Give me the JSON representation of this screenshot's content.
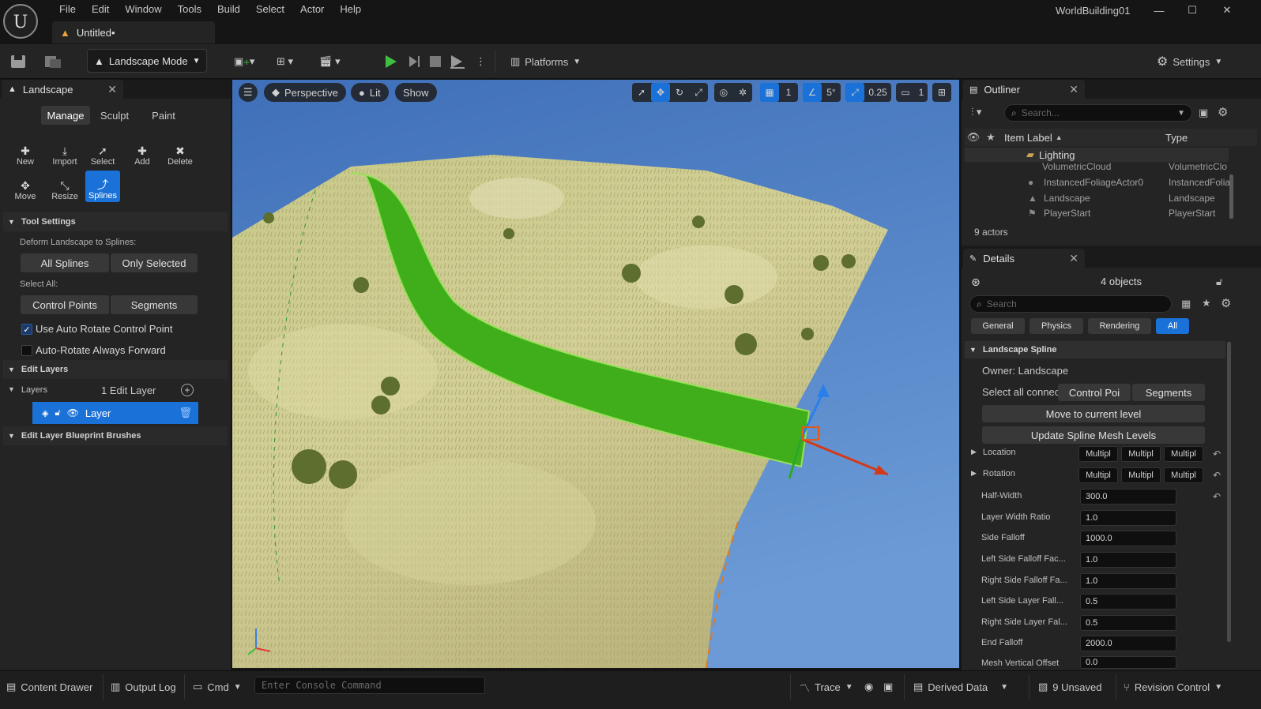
{
  "menu": {
    "items": [
      "File",
      "Edit",
      "Window",
      "Tools",
      "Build",
      "Select",
      "Actor",
      "Help"
    ]
  },
  "window": {
    "project_name": "WorldBuilding01",
    "doc_tab": "Untitled•"
  },
  "toolbar": {
    "mode": "Landscape Mode",
    "platforms": "Platforms",
    "settings": "Settings"
  },
  "landscape_panel": {
    "title": "Landscape",
    "tabs": [
      "Manage",
      "Sculpt",
      "Paint"
    ],
    "tools_row1": [
      "New",
      "Import",
      "Select",
      "Add",
      "Delete"
    ],
    "tools_row2": [
      "Move",
      "Resize",
      "Splines"
    ],
    "tool_settings": {
      "header": "Tool Settings",
      "deform_label": "Deform Landscape to Splines:",
      "all_splines": "All Splines",
      "only_selected": "Only Selected",
      "select_all_label": "Select All:",
      "control_points": "Control Points",
      "segments": "Segments",
      "auto_rotate": "Use Auto Rotate Control Point",
      "auto_rotate_forward": "Auto-Rotate Always Forward"
    },
    "edit_layers": {
      "header": "Edit Layers",
      "layers_label": "Layers",
      "layer_count": "1 Edit Layer",
      "layer_name": "Layer"
    },
    "blueprint_brushes": "Edit Layer Blueprint Brushes"
  },
  "viewport": {
    "perspective": "Perspective",
    "lit": "Lit",
    "show": "Show",
    "grid_value": "1",
    "angle_value": "5°",
    "scale_value": "0.25",
    "camera_speed": "1"
  },
  "outliner": {
    "title": "Outliner",
    "search_placeholder": "Search...",
    "col_label": "Item Label",
    "col_type": "Type",
    "folder": "Lighting",
    "rows": [
      {
        "label": "VolumetricCloud",
        "type": "VolumetricClo"
      },
      {
        "label": "InstancedFoliageActor0",
        "type": "InstancedFolia"
      },
      {
        "label": "Landscape",
        "type": "Landscape"
      },
      {
        "label": "PlayerStart",
        "type": "PlayerStart"
      }
    ],
    "actor_count": "9 actors"
  },
  "details": {
    "title": "Details",
    "objects": "4 objects",
    "search_placeholder": "Search",
    "filters": [
      "General",
      "Physics",
      "Rendering",
      "All"
    ],
    "section": "Landscape Spline",
    "owner": "Owner: Landscape",
    "select_all": "Select all connec",
    "control_points_btn": "Control Poi",
    "segments_btn": "Segments",
    "move_level": "Move to current level",
    "update_mesh": "Update Spline Mesh Levels",
    "location": "Location",
    "rotation": "Rotation",
    "multi": "Multipl",
    "props": [
      {
        "label": "Half-Width",
        "value": "300.0"
      },
      {
        "label": "Layer Width Ratio",
        "value": "1.0"
      },
      {
        "label": "Side Falloff",
        "value": "1000.0"
      },
      {
        "label": "Left Side Falloff Fac...",
        "value": "1.0"
      },
      {
        "label": "Right Side Falloff Fa...",
        "value": "1.0"
      },
      {
        "label": "Left Side Layer Fall...",
        "value": "0.5"
      },
      {
        "label": "Right Side Layer Fal...",
        "value": "0.5"
      },
      {
        "label": "End Falloff",
        "value": "2000.0"
      },
      {
        "label": "Mesh Vertical Offset",
        "value": "0.0"
      }
    ]
  },
  "statusbar": {
    "content_drawer": "Content Drawer",
    "output_log": "Output Log",
    "cmd": "Cmd",
    "console_placeholder": "Enter Console Command",
    "trace": "Trace",
    "derived_data": "Derived Data",
    "unsaved": "9 Unsaved",
    "revision": "Revision Control"
  },
  "colors": {
    "accent": "#1a72d8",
    "spline": "#3fae1a",
    "play": "#3fbf3f"
  }
}
